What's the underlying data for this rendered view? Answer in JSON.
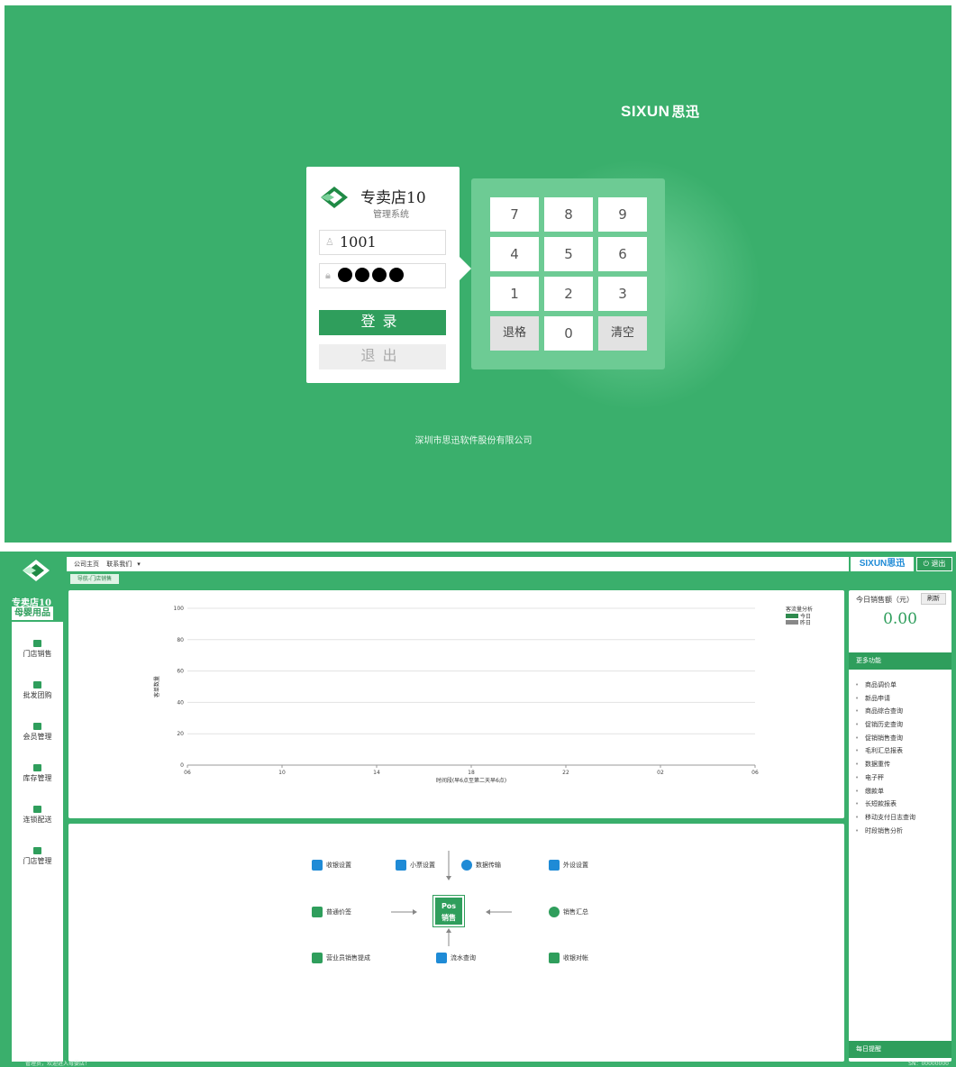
{
  "login": {
    "brand": "SIXUN",
    "brand_cn": "思迅",
    "app_title": "专卖店10",
    "app_subtitle": "管理系统",
    "username_value": "1001",
    "password_mask_count": 4,
    "login_button": "登录",
    "exit_button": "退出",
    "keypad": {
      "keys": [
        "7",
        "8",
        "9",
        "4",
        "5",
        "6",
        "1",
        "2",
        "3",
        "退格",
        "0",
        "清空"
      ]
    },
    "company": "深圳市思迅软件股份有限公司"
  },
  "main": {
    "sidebar": {
      "title": "专卖店10",
      "badge": "母婴用品",
      "items": [
        {
          "label": "门店销售"
        },
        {
          "label": "批发团购"
        },
        {
          "label": "会员管理"
        },
        {
          "label": "库存管理"
        },
        {
          "label": "连锁配送"
        },
        {
          "label": "门店管理"
        }
      ]
    },
    "topbar": {
      "home": "公司主页",
      "contact": "联系我们",
      "dropdown_icon": "▾",
      "brand": "SIXUN思迅",
      "logout": "退出"
    },
    "tab": "导航-门店销售",
    "chart_panel": {
      "legend_title": "客流量分析",
      "legend_today": "今日",
      "legend_yesterday": "昨日",
      "ylabel": "客单数量",
      "xlabel": "时间段(早6点至第二天早6点)"
    },
    "functions": {
      "cashier_settings": "收银设置",
      "ticket_settings": "小票设置",
      "data_transfer": "数据传输",
      "peripheral_settings": "外设设置",
      "price_check": "普通价签",
      "sales_summary": "销售汇总",
      "salesperson_commission": "营业员销售提成",
      "flow_query": "流水查询",
      "cashier_reconcile": "收银对帐",
      "center_line1": "Pos",
      "center_line2": "销售"
    },
    "right_panel": {
      "today_sales_label": "今日销售额（元）",
      "refresh": "刷新",
      "today_sales_value": "0.00",
      "more_functions": "更多功能",
      "links": [
        "商品调价单",
        "新品申请",
        "商品综合查询",
        "促销历史查询",
        "促销销售查询",
        "毛利汇总报表",
        "数据重传",
        "电子秤",
        "缴款单",
        "长短款报表",
        "移动支付日志查询",
        "时段销售分析"
      ],
      "daily_reminder": "每日提醒"
    },
    "status": {
      "welcome": "管理员，欢迎进入母婴店！",
      "serial": "SN：00000000"
    }
  },
  "colors": {
    "primary_green": "#3aaf6c",
    "dark_green": "#2f9e5c",
    "keypad_green": "#6dcb94",
    "brand_blue": "#1f8bd6"
  },
  "chart_data": {
    "type": "line",
    "x": [
      "06",
      "10",
      "14",
      "18",
      "22",
      "02",
      "06"
    ],
    "ylim": [
      0,
      100
    ],
    "yticks": [
      0,
      20,
      40,
      60,
      80,
      100
    ],
    "series": [
      {
        "name": "今日",
        "values": []
      },
      {
        "name": "昨日",
        "values": []
      }
    ],
    "xlabel": "时间段(早6点至第二天早6点)",
    "ylabel": "客单数量",
    "title": "",
    "legend_title": "客流量分析",
    "legend": "top-right",
    "grid": true,
    "series_colors": {
      "今日": "#2f8a4e",
      "昨日": "#888888"
    }
  }
}
